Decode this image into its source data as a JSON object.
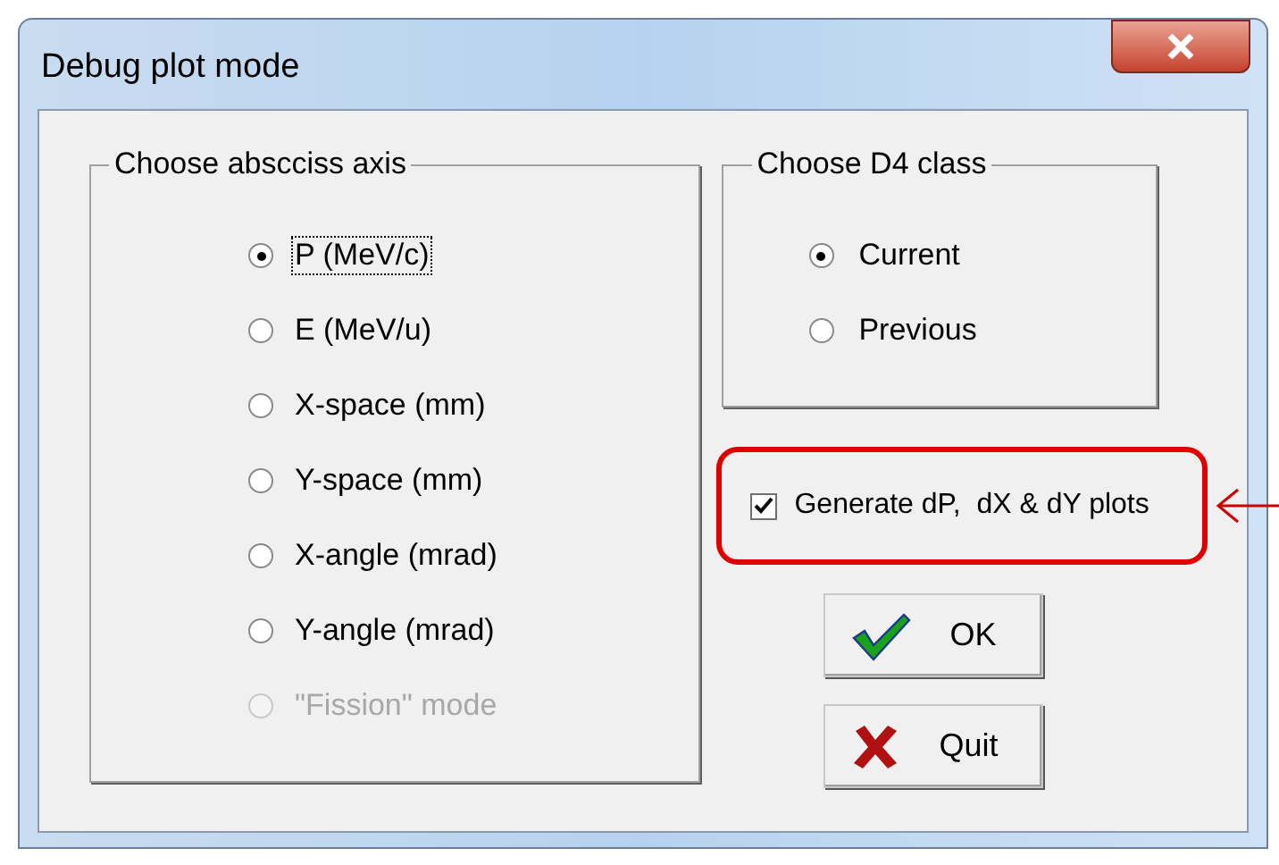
{
  "window": {
    "title": "Debug plot mode"
  },
  "abscissa_group": {
    "title": "Choose abscciss axis",
    "options": [
      {
        "label": "P (MeV/c)",
        "selected": true,
        "disabled": false,
        "focused": true
      },
      {
        "label": "E (MeV/u)",
        "selected": false,
        "disabled": false,
        "focused": false
      },
      {
        "label": "X-space (mm)",
        "selected": false,
        "disabled": false,
        "focused": false
      },
      {
        "label": "Y-space (mm)",
        "selected": false,
        "disabled": false,
        "focused": false
      },
      {
        "label": "X-angle (mrad)",
        "selected": false,
        "disabled": false,
        "focused": false
      },
      {
        "label": "Y-angle (mrad)",
        "selected": false,
        "disabled": false,
        "focused": false
      },
      {
        "label": "\"Fission\" mode",
        "selected": false,
        "disabled": true,
        "focused": false
      }
    ]
  },
  "d4_group": {
    "title": "Choose D4 class",
    "options": [
      {
        "label": "Current",
        "selected": true
      },
      {
        "label": "Previous",
        "selected": false
      }
    ]
  },
  "generate_plots": {
    "label": "Generate dP,  dX & dY plots",
    "checked": true,
    "highlighted": true
  },
  "buttons": [
    {
      "kind": "ok",
      "label": "OK"
    },
    {
      "kind": "quit",
      "label": "Quit"
    }
  ]
}
